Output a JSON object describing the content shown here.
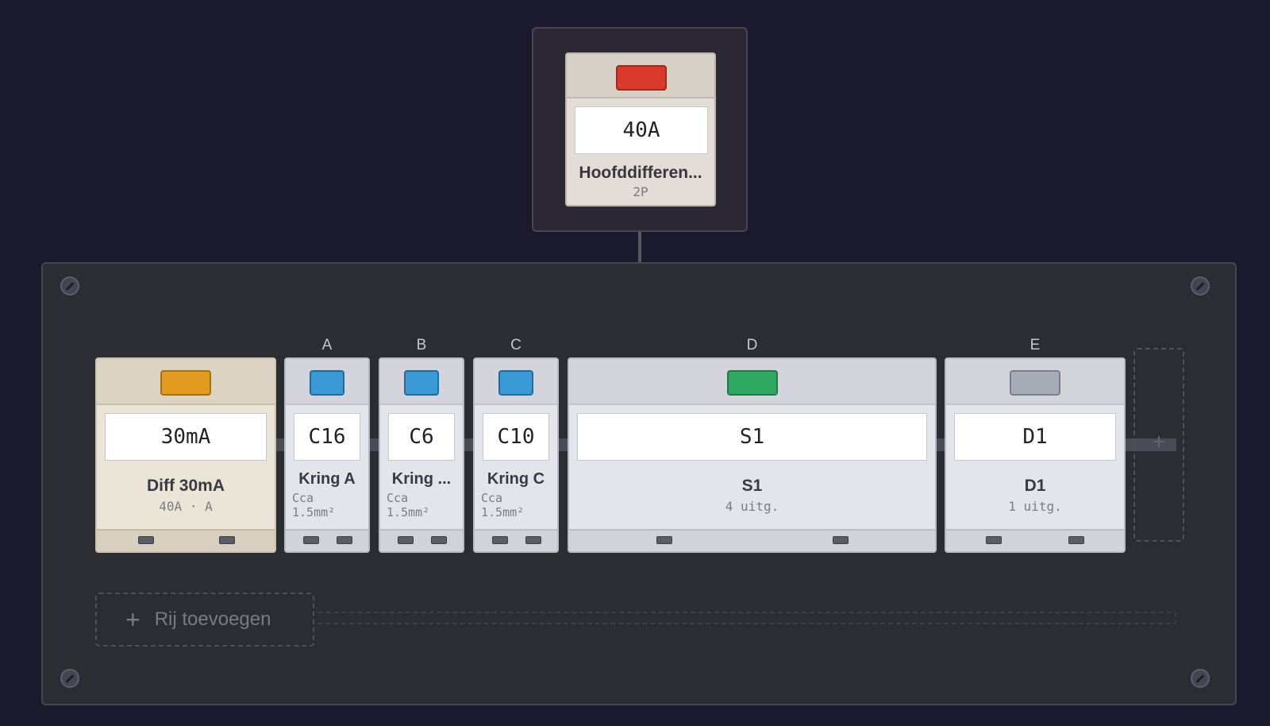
{
  "colors": {
    "toggle_red": "#d93a2b",
    "toggle_orange": "#e29a1f",
    "toggle_blue": "#3a9ad6",
    "toggle_green": "#2fa862",
    "toggle_gray": "#a7adb6"
  },
  "main_breaker": {
    "rating": "40A",
    "name": "Hoofddifferen...",
    "sub": "2P"
  },
  "row": {
    "diff": {
      "rating": "30mA",
      "name": "Diff 30mA",
      "detail": "40A · A"
    },
    "circuits": [
      {
        "label": "A",
        "rating": "C16",
        "name": "Kring A",
        "detail": "Cca\n1.5mm²"
      },
      {
        "label": "B",
        "rating": "C6",
        "name": "Kring ...",
        "detail": "Cca\n1.5mm²"
      },
      {
        "label": "C",
        "rating": "C10",
        "name": "Kring C",
        "detail": "Cca\n1.5mm²"
      },
      {
        "label": "D",
        "rating": "S1",
        "name": "S1",
        "detail": "4 uitg."
      },
      {
        "label": "E",
        "rating": "D1",
        "name": "D1",
        "detail": "1 uitg."
      }
    ]
  },
  "add_slot": {
    "icon": "plus"
  },
  "add_row": {
    "icon": "plus",
    "label": "Rij toevoegen"
  }
}
